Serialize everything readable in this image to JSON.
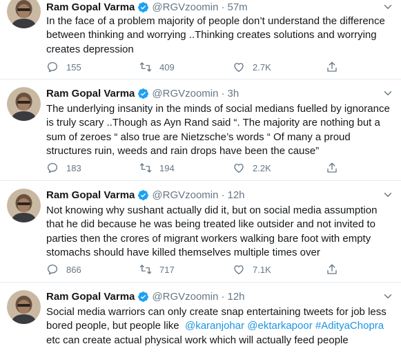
{
  "tweets": [
    {
      "name": "Ram Gopal Varma",
      "handle": "@RGVzoomin",
      "separator": "·",
      "time": "57m",
      "lines": [
        "In the face of a problem majority of people don’t understand the difference",
        "between thinking and worrying ..Thinking creates solutions and worrying",
        "creates depression"
      ],
      "replies": "155",
      "retweets": "409",
      "likes": "2.7K"
    },
    {
      "name": "Ram Gopal Varma",
      "handle": "@RGVzoomin",
      "separator": "·",
      "time": "3h",
      "lines": [
        "The underlying insanity in the minds of social medians fuelled by ignorance",
        "is truly scary ..Though as Ayn Rand said “. The majority are nothing but a",
        "sum of zeroes “ also true are  Nietzsche’s words “ Of many a proud",
        "structures ruin, weeds and rain drops have been the cause”"
      ],
      "replies": "183",
      "retweets": "194",
      "likes": "2.2K"
    },
    {
      "name": "Ram Gopal Varma",
      "handle": "@RGVzoomin",
      "separator": "·",
      "time": "12h",
      "lines": [
        "Not knowing why sushant actually did it, but on social media  assumption",
        "that he did because he was being treated like outsider and not invited to",
        "parties then the crores of migrant workers walking bare foot with empty",
        "stomachs should have killed themselves multiple times over"
      ],
      "replies": "866",
      "retweets": "717",
      "likes": "7.1K"
    },
    {
      "name": "Ram Gopal Varma",
      "handle": "@RGVzoomin",
      "separator": "·",
      "time": "12h",
      "lines": [
        "Social media warriors can only create snap entertaining tweets for job less",
        "bored people, but people like  "
      ],
      "mentions": [
        "@karanjohar",
        "@ektarkapoor",
        "#AdityaChopra"
      ],
      "last_line": "etc can create actual physical work which will actually feed people"
    }
  ],
  "colors": {
    "text": "#14171a",
    "muted": "#657786",
    "link": "#1b95e0",
    "verified": "#1da1f2",
    "divider": "#e6ecf0"
  },
  "icons": [
    "avatar-photo",
    "verified-badge-icon",
    "chevron-down-icon",
    "reply-icon",
    "retweet-icon",
    "like-icon",
    "share-icon"
  ]
}
